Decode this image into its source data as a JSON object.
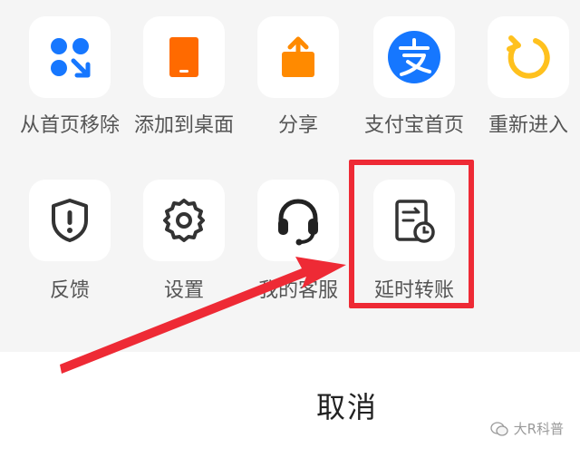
{
  "menu_row1": [
    {
      "label": "从首页移除",
      "icon": "remove-grid-icon"
    },
    {
      "label": "添加到桌面",
      "icon": "tablet-icon"
    },
    {
      "label": "分享",
      "icon": "share-icon"
    },
    {
      "label": "支付宝首页",
      "icon": "alipay-icon"
    },
    {
      "label": "重新进入",
      "icon": "refresh-icon"
    }
  ],
  "menu_row2": [
    {
      "label": "反馈",
      "icon": "feedback-shield-icon"
    },
    {
      "label": "设置",
      "icon": "gear-icon"
    },
    {
      "label": "我的客服",
      "icon": "headset-icon"
    },
    {
      "label": "延时转账",
      "icon": "delayed-transfer-icon"
    }
  ],
  "cancel_label": "取消",
  "watermark": "大R科普",
  "colors": {
    "accent_blue": "#1677ff",
    "orange": "#ff6a00",
    "yellow": "#ffc11e",
    "highlight_red": "#ee2a35"
  }
}
